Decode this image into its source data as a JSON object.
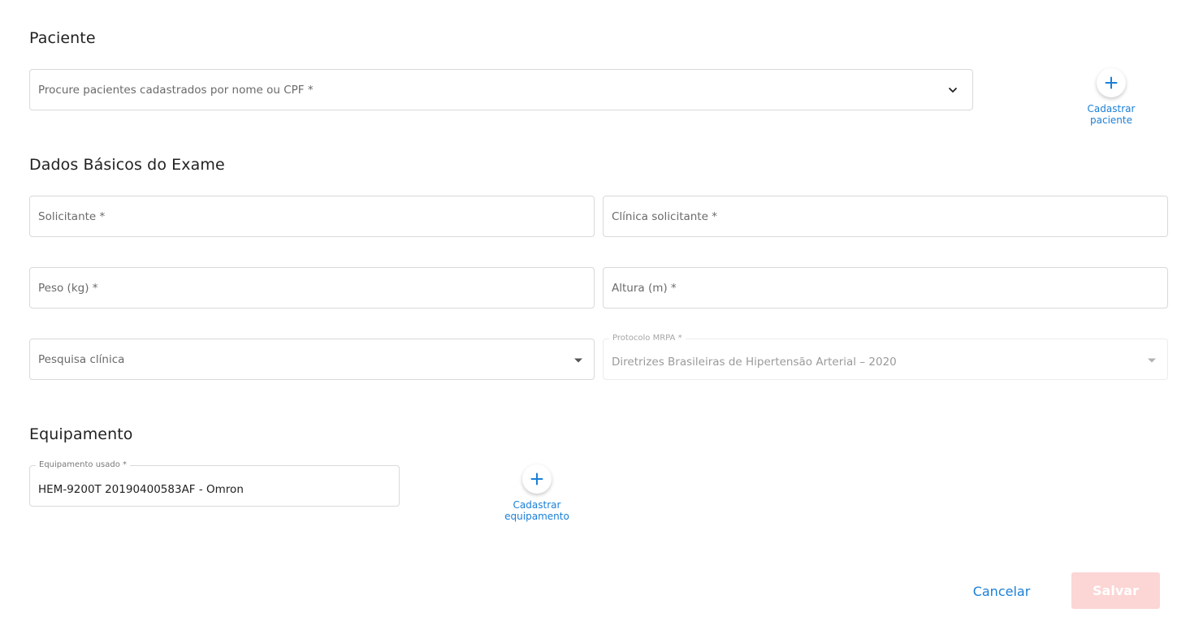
{
  "paciente": {
    "section_title": "Paciente",
    "search_placeholder": "Procure pacientes cadastrados por nome ou CPF *",
    "add_label_line1": "Cadastrar",
    "add_label_line2": "paciente"
  },
  "exame": {
    "section_title": "Dados Básicos do Exame",
    "solicitante_placeholder": "Solicitante *",
    "clinica_placeholder": "Clínica solicitante *",
    "peso_placeholder": "Peso (kg) *",
    "altura_placeholder": "Altura (m) *",
    "pesquisa_placeholder": "Pesquisa clínica",
    "protocolo_label": "Protocolo MRPA *",
    "protocolo_value": "Diretrizes Brasileiras de Hipertensão Arterial – 2020"
  },
  "equipamento": {
    "section_title": "Equipamento",
    "field_label": "Equipamento usado *",
    "field_value": "HEM-9200T 20190400583AF - Omron",
    "add_label_line1": "Cadastrar",
    "add_label_line2": "equipamento"
  },
  "actions": {
    "cancel_label": "Cancelar",
    "save_label": "Salvar"
  },
  "colors": {
    "accent": "#1a7fd6",
    "save_disabled_bg": "#fcd5d5",
    "border": "#d9d9d9"
  },
  "icons": {
    "add": "plus-icon",
    "dropdown": "chevron-down-icon",
    "select": "caret-down-icon"
  }
}
